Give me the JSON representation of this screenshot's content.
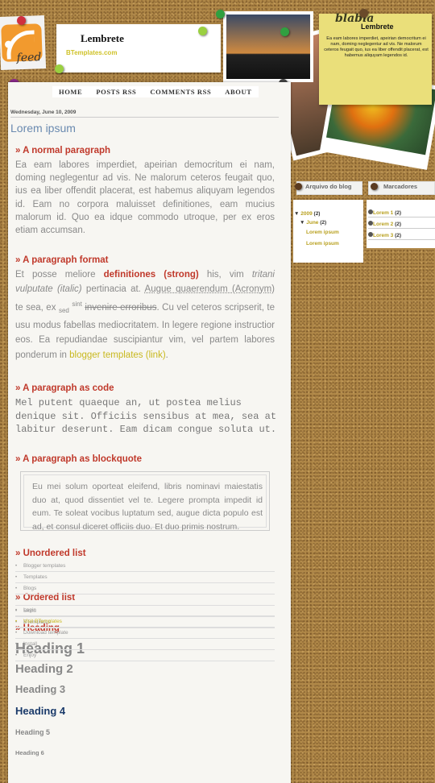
{
  "header": {
    "title": "Lembrete",
    "subtitle": "BTemplates.com",
    "feed_label": "feed"
  },
  "nav": [
    "HOME",
    "POSTS RSS",
    "COMMENTS RSS",
    "ABOUT"
  ],
  "sticky": {
    "scribble": "blabla",
    "title": "Lembrete",
    "text": "Ea eam labores imperdiet, apeirian democritum ei nam, doming neglegentur ad vis. Ne malorum ceteros feugait quo, ius ea liber offendit placerat, est habemus aliquyam legendos id."
  },
  "post": {
    "date": "Wednesday, June 10, 2009",
    "title": "Lorem ipsum",
    "h_normal": "» A normal paragraph",
    "normal": "Ea eam labores imperdiet, apeirian democritum ei nam, doming neglegentur ad vis. Ne malorum ceteros feugait quo, ius ea liber offendit placerat, est habemus aliquyam legendos id. Eam no corpora maluisset definitiones, eam mucius malorum id. Quo ea idque commodo utroque, per ex eros etiam accumsan.",
    "h_format": "» A paragraph format",
    "f1": "Et posse meliore ",
    "f_strong": "definitiones (strong)",
    "f2": " his, vim ",
    "f_italic": "tritani vulputate (italic)",
    "f3": " pertinacia at. ",
    "f_acronym": "Augue quaerendum (Acronym)",
    "f4": " te sea, ex ",
    "f_sub": "sed",
    "f_sup": "sint",
    "f_strike": "invenire erroribus",
    "f5": ". Cu vel ceteros scripserit, te usu modus fabellas mediocritatem. In legere regione instructior eos. Ea repudiandae suscipiantur vim, vel partem labores ponderum in ",
    "f_link": "blogger templates (link)",
    "f6": ".",
    "h_code": "» A paragraph as code",
    "code": "Mel putent quaeque an, ut postea melius denique sit. Officiis sensibus at mea, sea at labitur deserunt. Eam dicam congue soluta ut.",
    "h_quote": "» A paragraph as blockquote",
    "quote": "Eu mei solum oporteat eleifend, libris nominavi maiestatis duo at, quod dissentiet vel te. Legere prompta impedit id eum. Te soleat vocibus luptatum sed, augue dicta populo est ad, et consul diceret officiis duo. Et duo primis nostrum.",
    "h_ul": "» Unordered list",
    "ul": [
      "Blogger templates",
      "Templates",
      "Blogs",
      "",
      "Skins",
      "BTemplates"
    ],
    "h_ol": "» Ordered list",
    "ol": [
      "Login",
      "Visit BTemplates",
      "Download template",
      "Install",
      "Enjoy"
    ],
    "h_heading": "» Heading",
    "headings": [
      "Heading 1",
      "Heading 2",
      "Heading 3",
      "Heading 4",
      "Heading 5",
      "Heading 6"
    ]
  },
  "sidebar": {
    "archive": {
      "title": "Arquivo do blog",
      "year": "2009",
      "year_count": "(2)",
      "month": "June",
      "month_count": "(2)",
      "posts": [
        "Lorem ipsum",
        "Lorem ipsum"
      ]
    },
    "labels": {
      "title": "Marcadores",
      "items": [
        {
          "name": "Lorem 1",
          "count": "(2)"
        },
        {
          "name": "Lorem 2",
          "count": "(2)"
        },
        {
          "name": "Lorem 3",
          "count": "(2)"
        }
      ]
    }
  },
  "colors": {
    "accent_red": "#c0392b",
    "link_yellow": "#c8b81e",
    "title_blue": "#6a8ab0",
    "heading4_blue": "#1a3a6a"
  }
}
